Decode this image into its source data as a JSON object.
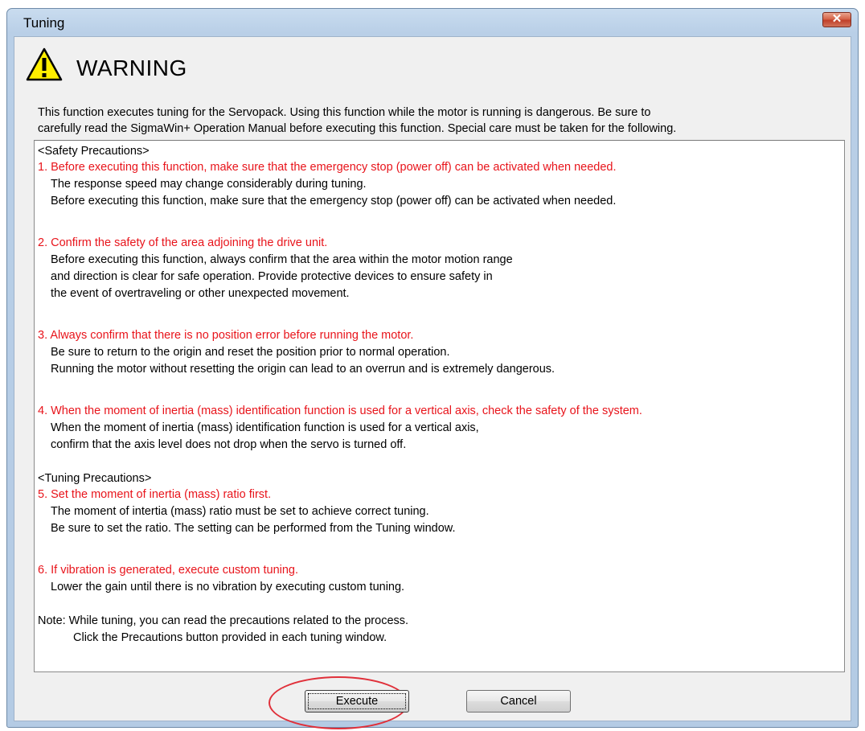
{
  "window": {
    "title": "Tuning"
  },
  "warning": {
    "heading": "WARNING",
    "intro_line1": "This function executes tuning for the Servopack. Using this function while the motor is running is dangerous. Be sure to",
    "intro_line2": "carefully read the SigmaWin+ Operation Manual before executing this function. Special care must be taken for the following."
  },
  "precautions": {
    "safety_header": "<Safety Precautions>",
    "p1_title": "1. Before executing this function, make sure that the emergency stop (power off) can be activated when needed.",
    "p1_l1": "The response speed may change considerably during tuning.",
    "p1_l2": "Before executing this function, make sure that the emergency stop (power off) can be activated when needed.",
    "p2_title": "2. Confirm the safety of the area adjoining the drive unit.",
    "p2_l1": "Before executing this function, always confirm that the area within the motor motion range",
    "p2_l2": "and direction is clear for safe operation. Provide protective devices to ensure safety in",
    "p2_l3": "the event of overtraveling or other unexpected movement.",
    "p3_title": "3. Always confirm that there is no position error before running the motor.",
    "p3_l1": "Be sure to return to the origin and reset the position prior to normal operation.",
    "p3_l2": "Running the motor without resetting the origin can lead to an overrun and is extremely dangerous.",
    "p4_title": "4. When the moment of inertia (mass) identification function is used for a vertical axis, check the safety of the system.",
    "p4_l1": "When the moment of inertia (mass) identification function is used for a vertical axis,",
    "p4_l2": "confirm that the axis level does not drop when the servo is turned off.",
    "tuning_header": "<Tuning Precautions>",
    "p5_title": "5. Set the moment of inertia (mass) ratio first.",
    "p5_l1": "The moment of intertia (mass) ratio must be set to achieve correct tuning.",
    "p5_l2": "Be sure to set the ratio. The setting can be performed from the Tuning window.",
    "p6_title": "6. If vibration is generated, execute custom tuning.",
    "p6_l1": "Lower the gain until there is no vibration by executing custom tuning.",
    "note_l1": "Note: While tuning, you can read the precautions related to the process.",
    "note_l2": "Click the Precautions button provided in each tuning window."
  },
  "buttons": {
    "execute": "Execute",
    "cancel": "Cancel"
  },
  "colors": {
    "precaution_title": "#e8141b",
    "highlight_circle": "#e0303a"
  },
  "icons": {
    "warning": "warning-triangle-icon",
    "close": "close-icon"
  }
}
